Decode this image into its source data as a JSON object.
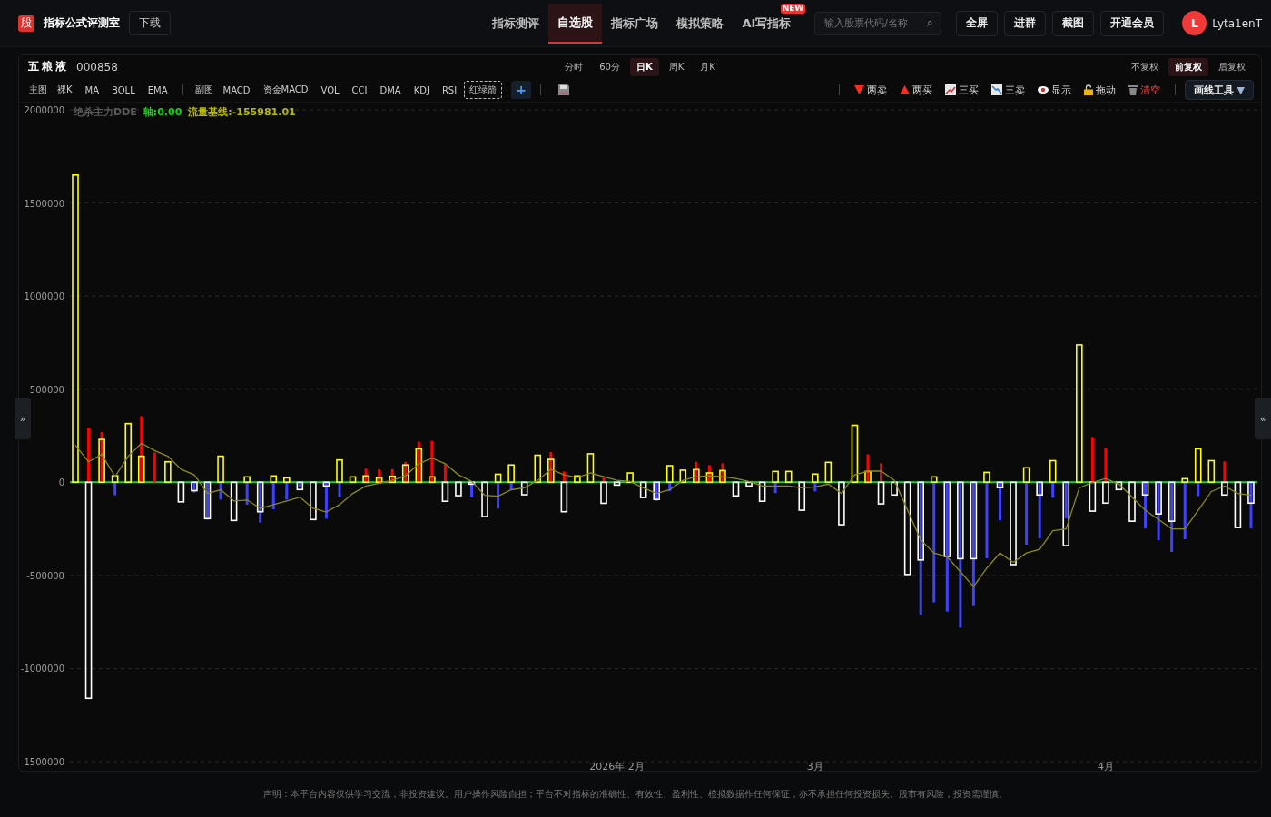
{
  "header": {
    "logo": "股",
    "title": "指标公式评测室",
    "download": "下载",
    "nav": [
      {
        "label": "指标测评",
        "selected": false
      },
      {
        "label": "自选股",
        "selected": true
      },
      {
        "label": "指标广场",
        "selected": false
      },
      {
        "label": "模拟策略",
        "selected": false
      },
      {
        "label": "AI写指标",
        "selected": false,
        "badge": "NEW"
      }
    ],
    "search": {
      "placeholder": "输入股票代码/名称",
      "icon": "⌕"
    },
    "buttons": [
      "全屏",
      "进群",
      "截图",
      "开通会员"
    ],
    "user": {
      "avatar": "L",
      "name": "Lyta1enT"
    }
  },
  "stock": {
    "name": "五粮液",
    "code": "000858"
  },
  "periods": [
    {
      "label": "分时",
      "selected": false
    },
    {
      "label": "60分",
      "selected": false
    },
    {
      "label": "日K",
      "selected": true
    },
    {
      "label": "周K",
      "selected": false
    },
    {
      "label": "月K",
      "selected": false
    }
  ],
  "adjust": [
    {
      "label": "不复权",
      "selected": false
    },
    {
      "label": "前复权",
      "selected": true
    },
    {
      "label": "后复权",
      "selected": false
    }
  ],
  "toolbar": {
    "main_label": "主图",
    "main_items": [
      "裸K",
      "MA",
      "BOLL",
      "EMA"
    ],
    "sub_label": "副图",
    "sub_items": [
      {
        "label": "MACD",
        "selected": false
      },
      {
        "label": "资金MACD",
        "selected": false
      },
      {
        "label": "VOL",
        "selected": false
      },
      {
        "label": "CCI",
        "selected": false
      },
      {
        "label": "DMA",
        "selected": false
      },
      {
        "label": "KDJ",
        "selected": false
      },
      {
        "label": "RSI",
        "selected": false
      },
      {
        "label": "红绿箭",
        "selected": true
      }
    ],
    "add": "+"
  },
  "draw_tools": [
    {
      "kind": "sell",
      "label": "两卖"
    },
    {
      "kind": "buy",
      "label": "两买"
    },
    {
      "kind": "up",
      "label": "三买"
    },
    {
      "kind": "down",
      "label": "三卖"
    },
    {
      "kind": "show",
      "label": "显示"
    },
    {
      "kind": "lock",
      "label": "拖动"
    },
    {
      "kind": "clear",
      "label": "清空"
    }
  ],
  "draw_menu": {
    "label": "画线工具",
    "caret": "▼"
  },
  "side_toggles": {
    "left": "»",
    "right": "«"
  },
  "legend": [
    {
      "label": "绝杀主力DDE",
      "color": "#5a5a5a"
    },
    {
      "label": "轴:0.00",
      "color": "#00e000"
    },
    {
      "label": "流量基线:-155981.01",
      "color": "#b8b800"
    }
  ],
  "chart": {
    "chart_data": {
      "type": "bar",
      "stacked": false,
      "grid": true,
      "ref_lines": [
        {
          "axis": "y",
          "value": 0,
          "color": "#1fcf3a"
        }
      ],
      "ylim": [
        -1500000,
        2000000
      ],
      "yticks": [
        2000000,
        1500000,
        1000000,
        500000,
        0,
        -500000,
        -1000000,
        -1500000
      ],
      "categories": [
        null,
        null,
        null,
        null,
        null,
        null,
        null,
        null,
        null,
        null,
        null,
        null,
        null,
        null,
        null,
        null,
        null,
        null,
        null,
        null,
        null,
        null,
        null,
        null,
        null,
        null,
        null,
        null,
        null,
        null,
        null,
        null,
        null,
        null,
        null,
        null,
        null,
        null,
        null,
        null,
        null,
        "2026年 2月",
        null,
        null,
        null,
        null,
        null,
        null,
        null,
        null,
        null,
        null,
        null,
        null,
        null,
        null,
        "3月",
        null,
        null,
        null,
        null,
        null,
        null,
        null,
        null,
        null,
        null,
        null,
        null,
        null,
        null,
        null,
        null,
        null,
        null,
        null,
        null,
        null,
        "4月",
        null,
        null,
        null,
        null,
        null,
        null,
        null,
        null,
        null,
        null,
        null
      ],
      "series": [
        {
          "color": "#ffff00",
          "values": [
            1650000,
            null,
            230000,
            35000,
            315000,
            140000,
            null,
            110000,
            null,
            null,
            null,
            140000,
            null,
            29000,
            null,
            34000,
            24000,
            null,
            null,
            null,
            120000,
            29000,
            34000,
            24000,
            32000,
            93000,
            180000,
            29000,
            null,
            null,
            null,
            null,
            43000,
            93000,
            null,
            145000,
            123000,
            null,
            34000,
            153000,
            null,
            null,
            50000,
            null,
            null,
            89000,
            65000,
            68000,
            50000,
            63000,
            null,
            null,
            null,
            58000,
            58000,
            null,
            44000,
            107000,
            null,
            306000,
            58000,
            null,
            null,
            null,
            null,
            29000,
            null,
            null,
            null,
            53000,
            null,
            null,
            78000,
            null,
            116000,
            null,
            738000,
            null,
            null,
            null,
            null,
            null,
            null,
            null,
            19000,
            180000,
            116000,
            null,
            null,
            null
          ]
        },
        {
          "color": "#ffffff",
          "values": [
            null,
            -1160000,
            null,
            null,
            null,
            null,
            null,
            null,
            -105000,
            -45000,
            -195000,
            null,
            -205000,
            null,
            -158000,
            null,
            null,
            -39000,
            -200000,
            -20000,
            null,
            null,
            null,
            null,
            null,
            null,
            null,
            null,
            -102000,
            -72000,
            -10000,
            -184000,
            null,
            null,
            -67000,
            null,
            null,
            -158000,
            null,
            null,
            -113000,
            -15000,
            null,
            -82000,
            -92000,
            null,
            null,
            null,
            null,
            null,
            -73000,
            -20000,
            -102000,
            null,
            null,
            -150000,
            null,
            null,
            -228000,
            null,
            null,
            -116000,
            -68000,
            -495000,
            -417000,
            null,
            -398000,
            -410000,
            -410000,
            null,
            -29000,
            -442000,
            null,
            -68000,
            null,
            -340000,
            null,
            -155000,
            -112000,
            -39000,
            -209000,
            -68000,
            -170000,
            -209000,
            null,
            null,
            null,
            -68000,
            -243000,
            -112000
          ]
        },
        {
          "color": "#ff0000",
          "values": [
            null,
            290000,
            270000,
            null,
            null,
            355000,
            160000,
            null,
            null,
            null,
            null,
            null,
            null,
            null,
            null,
            null,
            null,
            null,
            null,
            null,
            null,
            null,
            73000,
            70000,
            70000,
            110000,
            218000,
            222000,
            97000,
            null,
            null,
            null,
            null,
            null,
            null,
            null,
            162000,
            58000,
            null,
            null,
            32000,
            null,
            null,
            null,
            null,
            null,
            null,
            110000,
            92000,
            102000,
            null,
            null,
            null,
            null,
            null,
            null,
            null,
            null,
            null,
            null,
            150000,
            102000,
            null,
            null,
            null,
            null,
            null,
            null,
            null,
            null,
            null,
            null,
            null,
            null,
            null,
            null,
            null,
            243000,
            184000,
            null,
            null,
            null,
            null,
            null,
            null,
            null,
            null,
            112000,
            null,
            null
          ]
        },
        {
          "color": "#4040ff",
          "values": [
            null,
            null,
            null,
            -70000,
            null,
            null,
            null,
            null,
            null,
            -55000,
            -200000,
            -93000,
            null,
            -120000,
            -216000,
            -145000,
            -93000,
            -25000,
            null,
            -195000,
            -80000,
            null,
            null,
            null,
            null,
            null,
            null,
            null,
            null,
            null,
            -80000,
            null,
            -141000,
            -39000,
            null,
            null,
            null,
            null,
            null,
            null,
            null,
            null,
            null,
            null,
            -100000,
            -48000,
            null,
            null,
            null,
            null,
            null,
            null,
            null,
            -58000,
            null,
            null,
            -49000,
            null,
            null,
            null,
            null,
            null,
            null,
            null,
            -713000,
            -645000,
            -694000,
            -781000,
            -665000,
            -408000,
            -204000,
            null,
            -335000,
            -301000,
            -83000,
            -194000,
            null,
            null,
            null,
            null,
            null,
            -248000,
            -311000,
            -374000,
            -306000,
            -73000,
            null,
            null,
            null,
            -248000
          ]
        },
        {
          "type": "line",
          "color": "#8a8a1a",
          "values": [
            200000,
            110000,
            150000,
            30000,
            140000,
            210000,
            170000,
            140000,
            70000,
            40000,
            -60000,
            -40000,
            -100000,
            -95000,
            -140000,
            -120000,
            -100000,
            -80000,
            -140000,
            -160000,
            -120000,
            -60000,
            -20000,
            -5000,
            10000,
            35000,
            100000,
            130000,
            100000,
            40000,
            5000,
            -70000,
            -75000,
            -40000,
            -30000,
            10000,
            70000,
            40000,
            25000,
            50000,
            30000,
            10000,
            5000,
            -30000,
            -60000,
            -40000,
            10000,
            30000,
            35000,
            30000,
            20000,
            5000,
            -20000,
            -20000,
            -20000,
            -30000,
            -25000,
            -10000,
            -60000,
            40000,
            60000,
            60000,
            10000,
            -150000,
            -310000,
            -380000,
            -400000,
            -480000,
            -560000,
            -460000,
            -380000,
            -430000,
            -380000,
            -360000,
            -260000,
            -250000,
            -30000,
            0,
            20000,
            -10000,
            -80000,
            -150000,
            -200000,
            -250000,
            -250000,
            -150000,
            -50000,
            -20000,
            -60000,
            -70000
          ]
        }
      ]
    }
  },
  "disclaimer": "声明：本平台内容仅供学习交流，非投资建议。用户操作风险自担；平台不对指标的准确性、有效性、盈利性、模拟数据作任何保证，亦不承担任何投资损失。股市有风险，投资需谨慎。"
}
